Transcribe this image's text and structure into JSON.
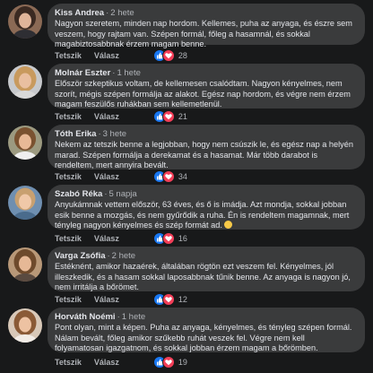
{
  "comments": [
    {
      "name": "Kiss Andrea",
      "time": "2 hete",
      "text": "Nagyon szeretem, minden nap hordom. Kellemes, puha az anyaga, és észre sem veszem, hogy rajtam van. Szépen formál, főleg a hasamnál, és sokkal magabiztosabbnak érzem magam benne.",
      "like_label": "Tetszik",
      "reply_label": "Válasz",
      "reactions": "28"
    },
    {
      "name": "Molnár Eszter",
      "time": "1 hete",
      "text": "Először szkeptikus voltam, de kellemesen csalódtam. Nagyon kényelmes, nem szorít, mégis szépen formálja az alakot. Egész nap hordom, és végre nem érzem magam feszülős ruhákban sem kellemetlenül.",
      "like_label": "Tetszik",
      "reply_label": "Válasz",
      "reactions": "21"
    },
    {
      "name": "Tóth Erika",
      "time": "3 hete",
      "text": "Nekem az tetszik benne a legjobban, hogy nem csúszik le, és egész nap a helyén marad. Szépen formálja a derekamat és a hasamat. Már több darabot is rendeltem, mert annyira bevált.",
      "like_label": "Tetszik",
      "reply_label": "Válasz",
      "reactions": "34"
    },
    {
      "name": "Szabó Réka",
      "time": "5 napja",
      "text": "Anyukámnak vettem először, 63 éves, és ő is imádja. Azt mondja, sokkal jobban esik benne a mozgás, és nem gyűrődik a ruha. Én is rendeltem magamnak, mert tényleg nagyon kényelmes és szép formát ad.",
      "like_label": "Tetszik",
      "reply_label": "Válasz",
      "reactions": "16"
    },
    {
      "name": "Varga Zsófia",
      "time": "2 hete",
      "text": "Estéknént, amikor hazaérek, általában rögtön ezt veszem fel. Kényelmes, jól illeszkedik, és a hasam sokkal laposabbnak tűnik benne. Az anyaga is nagyon jó, nem irritálja a bőrömet.",
      "like_label": "Tetszik",
      "reply_label": "Válasz",
      "reactions": "12"
    },
    {
      "name": "Horváth Noémi",
      "time": "1 hete",
      "text": "Pont olyan, mint a képen. Puha az anyaga, kényelmes, és tényleg szépen formál. Nálam bevált, főleg amikor szűkebb ruhát veszek fel. Végre nem kell folyamatosan igazgatnom, és sokkal jobban érzem magam a bőrömben.",
      "like_label": "Tetszik",
      "reply_label": "Válasz",
      "reactions": "19"
    }
  ],
  "colors": {
    "background": "#18191a",
    "bubble": "#3a3b3c",
    "like": "#1877f2",
    "love": "#f33e58"
  }
}
